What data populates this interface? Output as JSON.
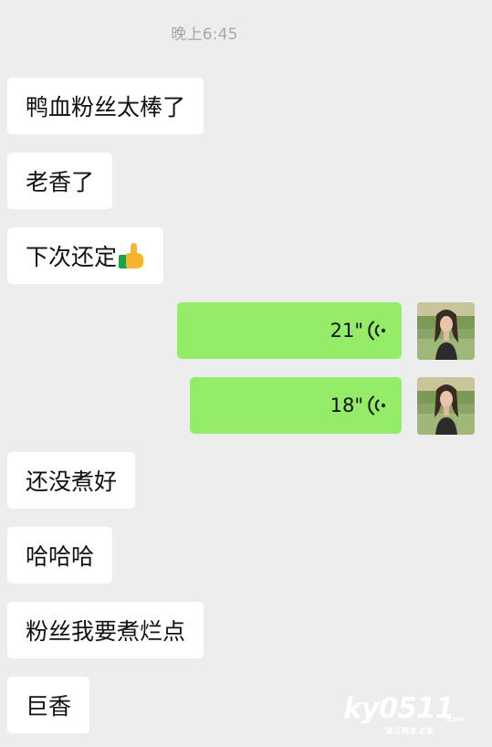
{
  "chat": {
    "timestamp": "晚上6:45",
    "messages": [
      {
        "sender": "other",
        "type": "text",
        "text": "鸭血粉丝太棒了"
      },
      {
        "sender": "other",
        "type": "text",
        "text": "老香了"
      },
      {
        "sender": "other",
        "type": "text",
        "text": "下次还定",
        "emoji": "thumbs-up-icon"
      },
      {
        "sender": "self",
        "type": "voice",
        "duration": "21\""
      },
      {
        "sender": "self",
        "type": "voice",
        "duration": "18\""
      },
      {
        "sender": "other",
        "type": "text",
        "text": "还没煮好"
      },
      {
        "sender": "other",
        "type": "text",
        "text": "哈哈哈"
      },
      {
        "sender": "other",
        "type": "text",
        "text": "粉丝我要煮烂点"
      },
      {
        "sender": "other",
        "type": "text",
        "text": "巨香"
      }
    ]
  },
  "watermark": {
    "main": "ky0511",
    "suffix": ".com",
    "sub": "镇江网友之家"
  },
  "colors": {
    "background": "#ededed",
    "incoming_bubble": "#ffffff",
    "outgoing_bubble": "#95ec69",
    "timestamp_text": "#a8a8a8"
  }
}
